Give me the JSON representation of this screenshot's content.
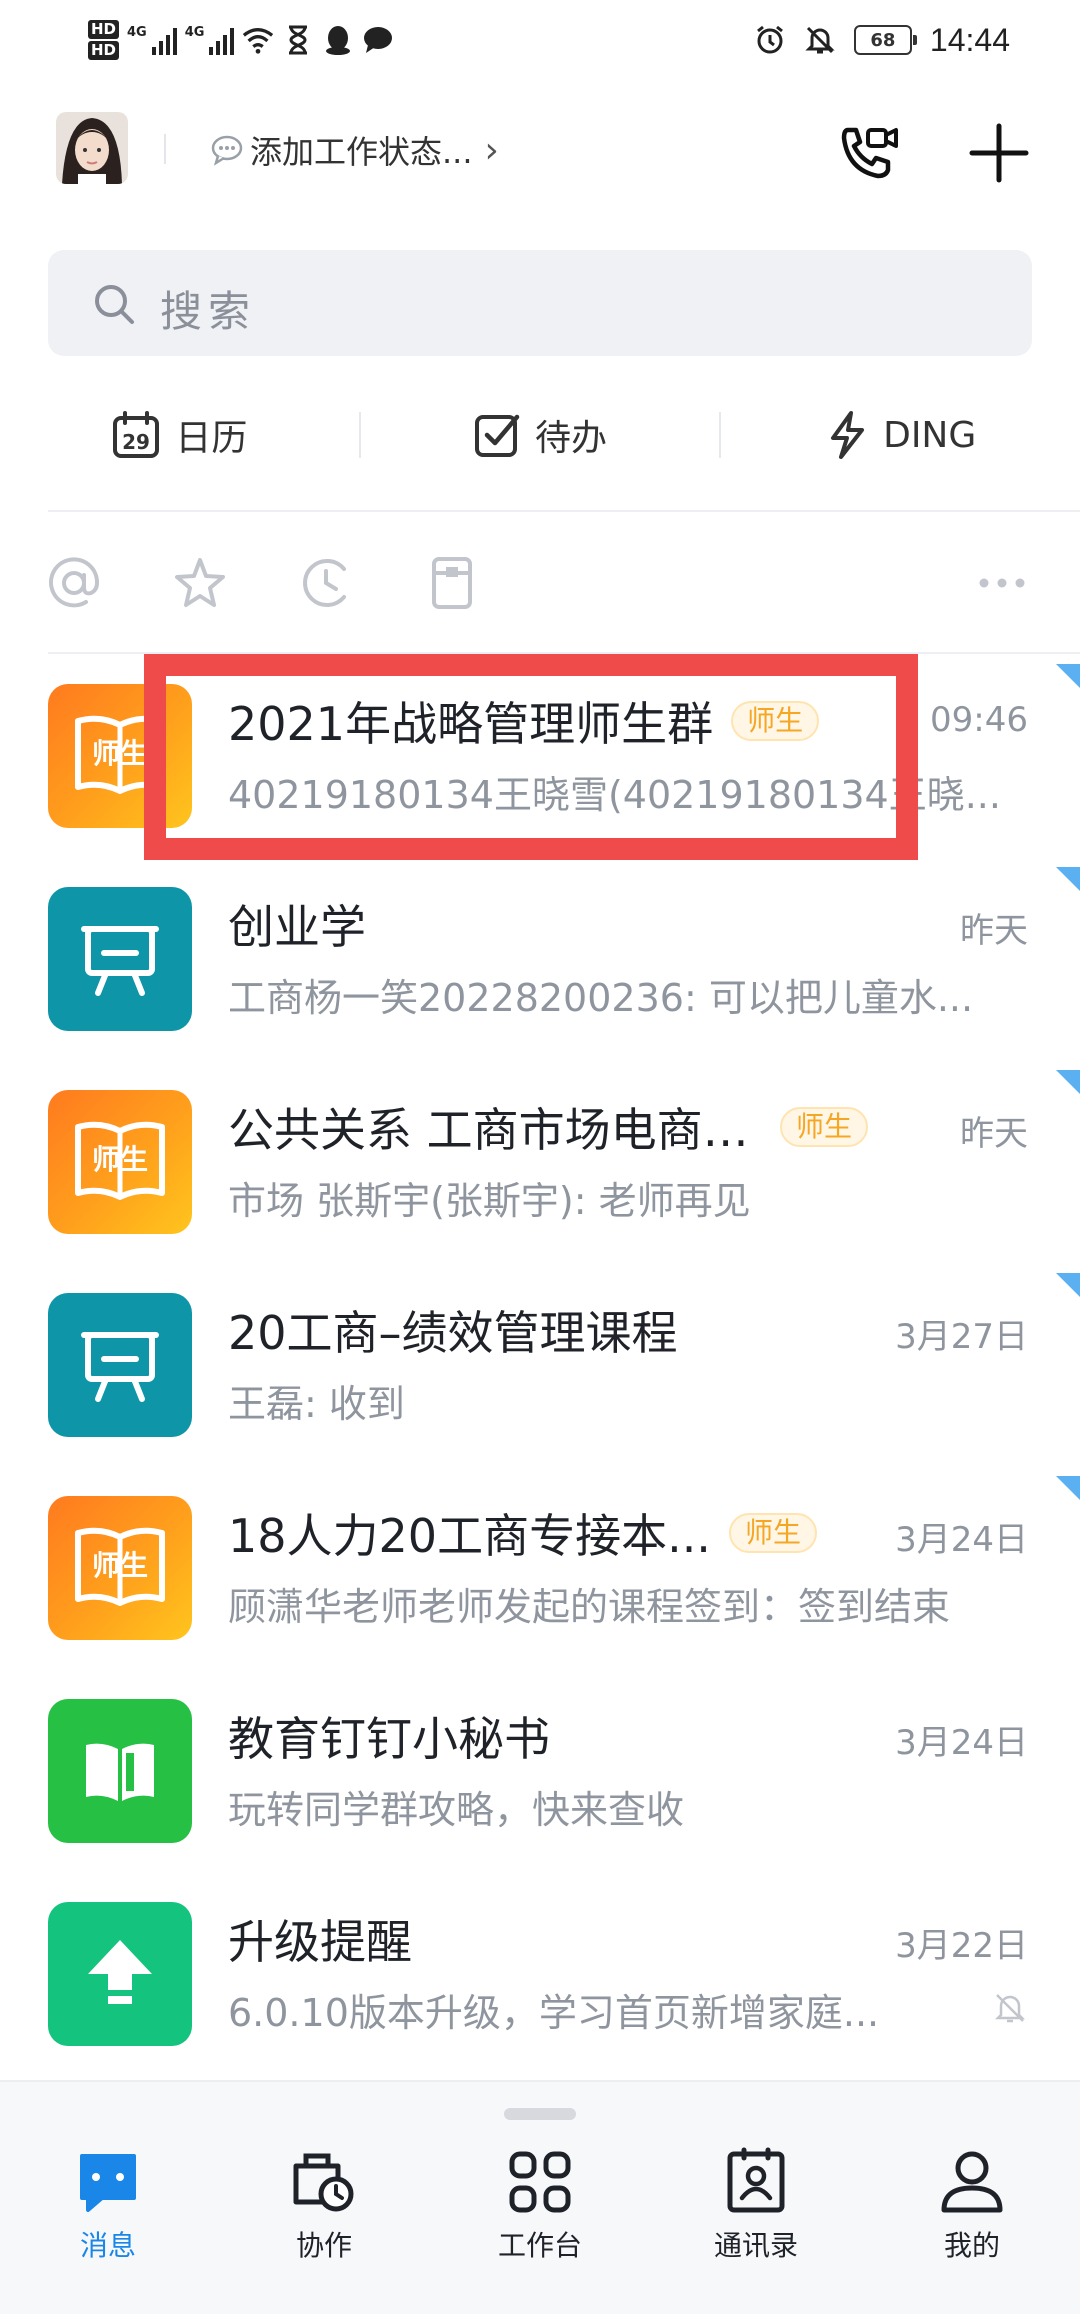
{
  "status_bar": {
    "hd_1": "HD",
    "hd_2": "HD",
    "net_1": "4G",
    "net_2": "4G",
    "battery": "68",
    "time": "14:44"
  },
  "header": {
    "work_status": "添加工作状态...",
    "work_status_icon": "chat-bubble-icon",
    "chevron": "›"
  },
  "search": {
    "placeholder": "搜索"
  },
  "quick_actions": [
    {
      "label": "日历",
      "icon": "calendar-icon",
      "day": "29"
    },
    {
      "label": "待办",
      "icon": "checkbox-icon"
    },
    {
      "label": "DING",
      "icon": "lightning-icon"
    }
  ],
  "filters": [
    "at-icon",
    "star-icon",
    "clock-icon",
    "folder-icon",
    "more-icon"
  ],
  "conversations": [
    {
      "title": "2021年战略管理师生群",
      "badge": "师生",
      "time": "09:46",
      "preview": "40219180134王晓雪(40219180134王晓...",
      "icon": "teacher-student-book-icon",
      "icon_text": "师生",
      "color": "#ff9a1d"
    },
    {
      "title": "创业学",
      "badge": "",
      "time": "昨天",
      "preview": "工商杨一笑20228200236: 可以把儿童水...",
      "icon": "classroom-board-icon",
      "color": "#0e96a8"
    },
    {
      "title": "公共关系 工商市场电商1...",
      "badge": "师生",
      "time": "昨天",
      "preview": "市场 张斯宇(张斯宇): 老师再见",
      "icon": "teacher-student-book-icon",
      "icon_text": "师生",
      "color": "#ff9a1d"
    },
    {
      "title": "20工商–绩效管理课程",
      "badge": "",
      "time": "3月27日",
      "preview": "王磊: 收到",
      "icon": "classroom-board-icon",
      "color": "#0e96a8"
    },
    {
      "title": "18人力20工商专接本...",
      "badge": "师生",
      "time": "3月24日",
      "preview": "顾潇华老师老师发起的课程签到：签到结束",
      "icon": "teacher-student-book-icon",
      "icon_text": "师生",
      "color": "#ff9a1d"
    },
    {
      "title": "教育钉钉小秘书",
      "badge": "",
      "time": "3月24日",
      "preview": "玩转同学群攻略，快来查收",
      "icon": "open-book-icon",
      "color": "#26c044"
    },
    {
      "title": "升级提醒",
      "badge": "",
      "time": "3月22日",
      "preview": "6.0.10版本升级，学习首页新增家庭...",
      "icon": "upgrade-arrow-icon",
      "color": "#14c37e",
      "muted": true
    }
  ],
  "bottom_nav": [
    {
      "label": "消息",
      "icon": "message-icon",
      "active": true
    },
    {
      "label": "协作",
      "icon": "collaborate-icon"
    },
    {
      "label": "工作台",
      "icon": "workbench-icon"
    },
    {
      "label": "通讯录",
      "icon": "contacts-icon"
    },
    {
      "label": "我的",
      "icon": "profile-icon"
    }
  ],
  "colors": {
    "accent": "#1a86e8",
    "highlight_border": "#ef4b4b",
    "badge_text": "#f5a623"
  }
}
